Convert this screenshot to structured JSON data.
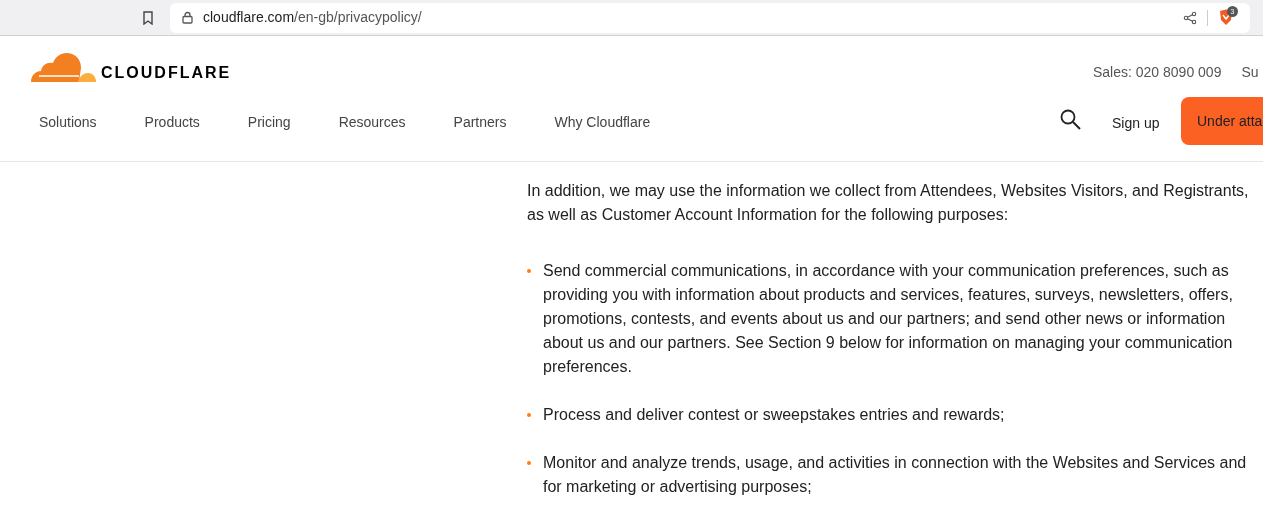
{
  "browser": {
    "url_host": "cloudflare.com",
    "url_path": "/en-gb/privacypolicy/",
    "shield_count": "3"
  },
  "header": {
    "logo_text": "CLOUDFLARE",
    "top_links": [
      "Sales: 020 8090 009",
      "Su"
    ],
    "nav": [
      "Solutions",
      "Products",
      "Pricing",
      "Resources",
      "Partners",
      "Why Cloudflare"
    ],
    "sign_up": "Sign up",
    "cta": "Under atta"
  },
  "content": {
    "intro": "In addition, we may use the information we collect from Attendees, Websites Visitors, and Registrants, as well as Customer Account Information for the following purposes:",
    "bullets": [
      "Send commercial communications, in accordance with your communication preferences, such as providing you with information about products and services, features, surveys, newsletters, offers, promotions, contests, and events about us and our partners; and send other news or information about us and our partners. See Section 9 below for information on managing your communication preferences.",
      "Process and deliver contest or sweepstakes entries and rewards;",
      "Monitor and analyze trends, usage, and activities in connection with the Websites and Services and for marketing or advertising purposes;"
    ]
  }
}
